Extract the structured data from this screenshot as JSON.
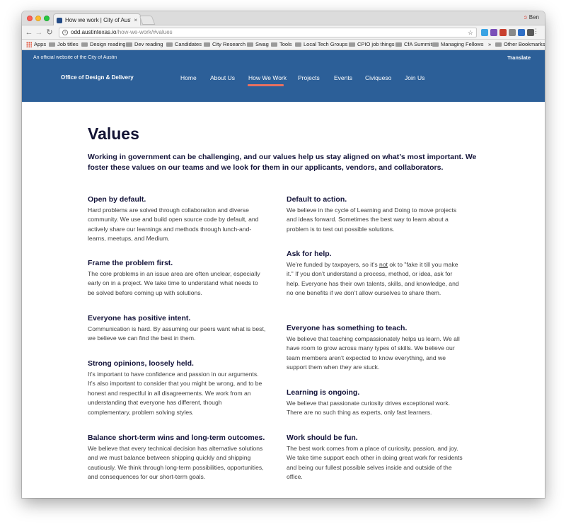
{
  "browser": {
    "tab_title": "How we work | City of Austin D",
    "tab_close": "×",
    "profile_name": "Ben",
    "url_host": "odd.austintexas.io",
    "url_path": "/how-we-work/#values",
    "bookmarks": [
      "Apps",
      "Job titles",
      "Design reading",
      "Dev reading",
      "Candidates",
      "City Research",
      "Swag",
      "Tools",
      "Local Tech Groups",
      "CPIO job things",
      "CfA Summit",
      "Managing Fellows"
    ],
    "bookmarks_overflow": "»",
    "other_bookmarks": "Other Bookmarks"
  },
  "site": {
    "official_notice": "An official website of the City of Austin",
    "translate_label": "Translate",
    "brand": "Office of Design & Delivery",
    "nav": [
      "Home",
      "About Us",
      "How We Work",
      "Projects",
      "Events",
      "Civiqueso",
      "Join Us"
    ],
    "nav_active": "How We Work",
    "accent_color": "#2c5f98"
  },
  "page": {
    "title": "Values",
    "intro": "Working in government can be challenging, and our values help us stay aligned on what’s most important. We foster these values on our teams and we look for them in our applicants, vendors, and collaborators.",
    "values_left": [
      {
        "heading": "Open by default.",
        "body": "Hard problems are solved through collaboration and diverse community. We use and build open source code by default, and actively share our learnings and methods through lunch-and-learns, meetups, and Medium."
      },
      {
        "heading": "Frame the problem first.",
        "body": "The core problems in an issue area are often unclear, especially early on in a project. We take time to understand what needs to be solved before coming up with solutions."
      },
      {
        "heading": "Everyone has positive intent.",
        "body": "Communication is hard. By assuming our peers want what is best, we believe we can find the best in them."
      },
      {
        "heading": "Strong opinions, loosely held.",
        "body": "It’s important to have confidence and passion in our arguments. It’s also important to consider that you might be wrong, and to be honest and respectful in all disagreements. We work from an understanding that everyone has different, though complementary, problem solving styles."
      },
      {
        "heading": "Balance short-term wins and long-term outcomes.",
        "body": "We believe that every technical decision has alternative solutions and we must balance between shipping quickly and shipping cautiously. We think through long-term possibilities, opportunities, and consequences for our short-term goals."
      }
    ],
    "values_right": [
      {
        "heading": "Default to action.",
        "body": "We believe in the cycle of Learning and Doing to move projects and ideas forward. Sometimes the best way to learn about a problem is to test out possible solutions."
      },
      {
        "heading": "Ask for help.",
        "body_pre": "We’re funded by taxpayers, so it’s ",
        "body_underlined": "not",
        "body_post": " ok to \"fake it till you make it.\" If you don’t understand a process, method, or idea, ask for help. Everyone has their own talents, skills, and knowledge, and no one benefits if we don’t allow ourselves to share them."
      },
      {
        "heading": "Everyone has something to teach.",
        "body": "We believe that teaching compassionately helps us learn. We all have room to grow across many types of skills. We believe our team members aren’t expected to know everything, and we support them when they are stuck."
      },
      {
        "heading": "Learning is ongoing.",
        "body": "We believe that passionate curiosity drives exceptional work. There are no such thing as experts, only fast learners."
      },
      {
        "heading": "Work should be fun.",
        "body": "The best work comes from a place of curiosity, passion, and joy. We take time support each other in doing great work for residents and being our fullest possible selves inside and outside of the office."
      }
    ]
  }
}
